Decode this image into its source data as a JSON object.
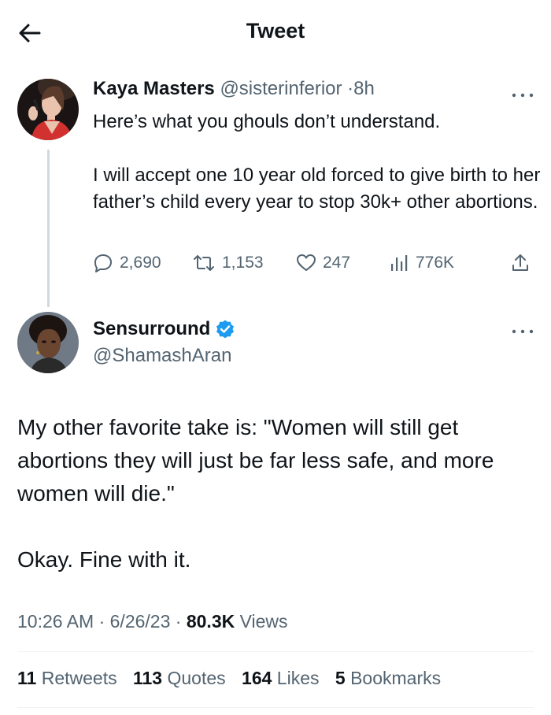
{
  "header": {
    "title": "Tweet",
    "back_icon": "arrow-left-icon"
  },
  "original_tweet": {
    "display_name": "Kaya Masters",
    "handle": "@sisterinferior",
    "separator": "·",
    "time": "8h",
    "text_line_1": "Here’s what you ghouls don’t understand.",
    "text_line_2": "I will accept one 10 year old forced to give birth to her father’s child every year to stop 30k+ other abortions.",
    "replies": "2,690",
    "retweets": "1,153",
    "likes": "247",
    "views": "776K"
  },
  "quote_tweet": {
    "display_name": "Sensurround",
    "verified": true,
    "handle": "@ShamashAran",
    "text_line_1": "My other favorite take is: \"Women will still get abortions they will just be far less safe, and more women will die.\"",
    "text_line_2": "Okay.  Fine with it.",
    "time": "10:26 AM",
    "date": "6/26/23",
    "sep1": "·",
    "sep2": "·",
    "views_count": "80.3K",
    "views_label": "Views"
  },
  "stats": {
    "retweets_count": "11",
    "retweets_label": "Retweets",
    "quotes_count": "113",
    "quotes_label": "Quotes",
    "likes_count": "164",
    "likes_label": "Likes",
    "bookmarks_count": "5",
    "bookmarks_label": "Bookmarks"
  },
  "colors": {
    "text": "#0f1419",
    "secondary": "#536471",
    "verified": "#1d9bf0",
    "divider": "#eff3f4"
  }
}
